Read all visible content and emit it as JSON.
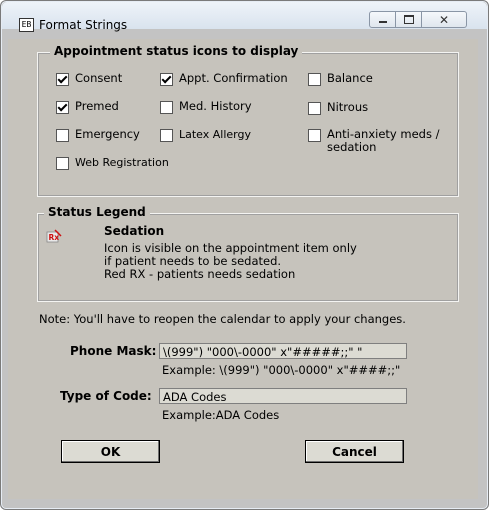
{
  "window": {
    "title": "Format Strings",
    "icon_text": "EB"
  },
  "appointment_group": {
    "label": "Appointment status icons to display",
    "checkboxes": [
      {
        "label": "Consent",
        "checked": true
      },
      {
        "label": "Appt. Confirmation",
        "checked": true
      },
      {
        "label": "Balance",
        "checked": false
      },
      {
        "label": "Premed",
        "checked": true
      },
      {
        "label": "Med. History",
        "checked": false
      },
      {
        "label": "Nitrous",
        "checked": false
      },
      {
        "label": "Emergency",
        "checked": false
      },
      {
        "label": "Latex Allergy",
        "checked": false
      },
      {
        "label": "Anti-anxiety meds /\nsedation",
        "checked": false
      },
      {
        "label": "Web Registration",
        "checked": false
      }
    ]
  },
  "status_legend": {
    "label": "Status Legend",
    "icon_name": "rx-icon",
    "item_title": "Sedation",
    "line1": "Icon is visible on the appointment item only",
    "line2": "if patient needs to be sedated.",
    "line3": "Red RX - patients needs sedation"
  },
  "note": "Note: You'll have to reopen the calendar to apply your changes.",
  "phone_mask": {
    "label": "Phone Mask:",
    "value": "\\(999\") \"000\\-0000\" x\"#####;;\" \"",
    "example": "Example: \\(999\") \"000\\-0000\" x\"####;;\""
  },
  "type_of_code": {
    "label": "Type of Code:",
    "value": "ADA Codes",
    "example": "Example:ADA Codes"
  },
  "buttons": {
    "ok": "OK",
    "cancel": "Cancel"
  },
  "colors": {
    "panel": "#c6c3bc",
    "field": "#dcdbd3",
    "rx_red": "#cc1111"
  }
}
